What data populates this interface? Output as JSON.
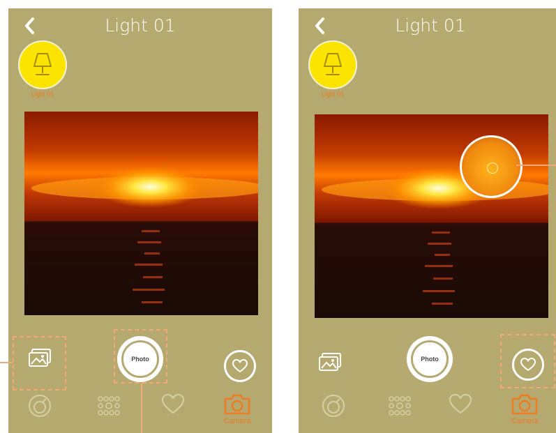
{
  "screens": [
    {
      "title": "Light 01",
      "device_label": "Light 01",
      "shutter_label": "Photo",
      "tabs": [
        {
          "icon": "color-wheel-icon",
          "label": ""
        },
        {
          "icon": "scenes-dots-icon",
          "label": ""
        },
        {
          "icon": "heart-icon",
          "label": ""
        },
        {
          "icon": "camera-icon",
          "label": "Camera"
        }
      ]
    },
    {
      "title": "Light 01",
      "device_label": "Light 01",
      "shutter_label": "Photo",
      "tabs": [
        {
          "icon": "color-wheel-icon",
          "label": ""
        },
        {
          "icon": "scenes-dots-icon",
          "label": ""
        },
        {
          "icon": "heart-icon",
          "label": ""
        },
        {
          "icon": "camera-icon",
          "label": "Camera"
        }
      ]
    }
  ],
  "colors": {
    "screen_bg": "#b5a970",
    "bulb": "#fbe400",
    "accent": "#ef7c1f",
    "dashed_highlight": "#f2a978",
    "icon_inactive": "#d6cfa6"
  }
}
